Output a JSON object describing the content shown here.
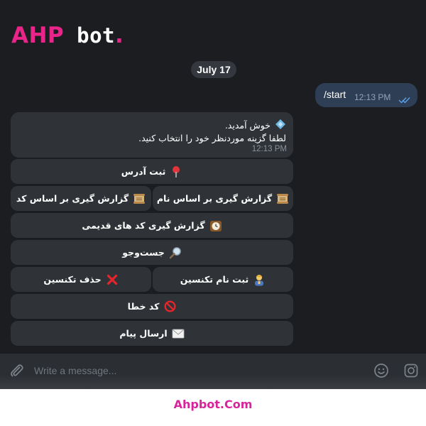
{
  "brand": {
    "logo_part1": "AHP",
    "logo_part2": " bot",
    "logo_part3": ".",
    "footer": "Ahpbot.Com",
    "accent_color": "#e9258a"
  },
  "chat": {
    "date_label": "July 17",
    "outgoing": {
      "text": "/start",
      "time": "12:13 PM",
      "status_icon": "double-check-icon"
    },
    "incoming": {
      "line1": "خوش آمدید.",
      "line1_icon": "diamond-icon",
      "line2": "لطفا گزینه موردنظر خود را انتخاب کنید.",
      "time": "12:13 PM"
    },
    "keyboard": [
      {
        "label": "ثبت آدرس",
        "icon": "pin-icon"
      },
      {
        "label": "گزارش گیری بر اساس نام",
        "icon": "scroll-icon"
      },
      {
        "label": "گزارش گیری بر اساس کد",
        "icon": "scroll-icon"
      },
      {
        "label": "گزارش گیری کد های قدیمی",
        "icon": "clock-icon"
      },
      {
        "label": "جست‌وجو",
        "icon": "magnifier-icon"
      },
      {
        "label": "ثبت نام تکنسین",
        "icon": "technician-icon"
      },
      {
        "label": "حذف تکنسین",
        "icon": "cross-mark-icon"
      },
      {
        "label": "کد خطا",
        "icon": "prohibited-icon"
      },
      {
        "label": "ارسال پیام",
        "icon": "envelope-icon"
      }
    ]
  },
  "composer": {
    "placeholder": "Write a message...",
    "attach_icon": "paperclip-icon",
    "emoji_icon": "smile-icon",
    "camera_icon": "instagram-icon"
  }
}
